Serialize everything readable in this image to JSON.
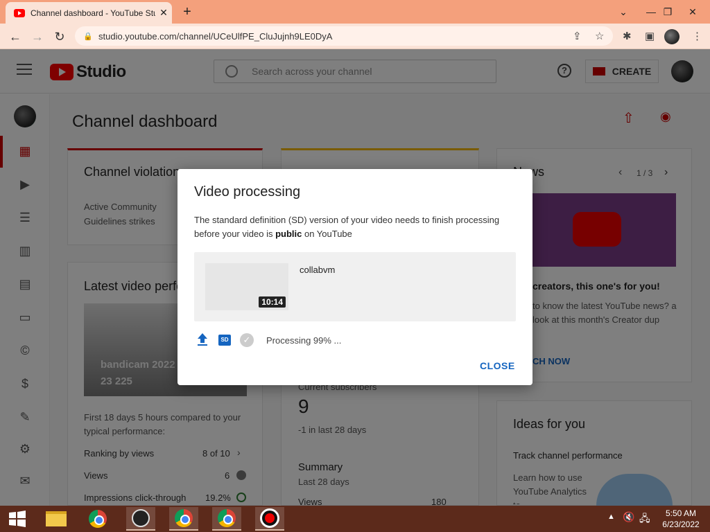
{
  "browser": {
    "tab_title": "Channel dashboard - YouTube Studio",
    "new_tab": "+",
    "tab_close": "✕",
    "url": "studio.youtube.com/channel/UCeUlfPE_CluJujnh9LE0DyA",
    "window_controls": [
      "⌄",
      "—",
      "❐",
      "✕"
    ]
  },
  "header": {
    "logo_text": "Studio",
    "search_placeholder": "Search across your channel",
    "help": "?",
    "create_label": "CREATE"
  },
  "page": {
    "title": "Channel dashboard"
  },
  "cards": {
    "violations": {
      "title": "Channel violations",
      "line1": "Active Community",
      "line2": "Guidelines strikes"
    },
    "latest": {
      "title": "Latest video performance",
      "thumb_title": "bandicam 2022",
      "thumb_views": "23 225",
      "compare": "First 18 days 5 hours compared to your typical performance:",
      "rows": [
        {
          "label": "Ranking by views",
          "value": "8 of 10"
        },
        {
          "label": "Views",
          "value": "6"
        },
        {
          "label": "Impressions click-through",
          "value": "19.2%"
        }
      ]
    },
    "analytics": {
      "subs_label": "Current subscribers",
      "subs_value": "9",
      "subs_change": "-1 in last 28 days",
      "summary": "Summary",
      "summary_sub": "Last 28 days",
      "views_label": "Views",
      "views_value": "180"
    },
    "news": {
      "title": "News",
      "pager": "1 / 3",
      "headline": "creators, this one's for you!",
      "body": "to know the latest YouTube news? a look at this month's Creator dup",
      "cta": "CH NOW"
    },
    "ideas": {
      "title": "Ideas for you",
      "sub": "Track channel performance",
      "body": "Learn how to use YouTube Analytics to"
    }
  },
  "dialog": {
    "title": "Video processing",
    "body_prefix": "The standard definition (SD) version of your video needs to finish processing before your video is ",
    "body_bold": "public",
    "body_suffix": " on YouTube",
    "video_name": "collabvm",
    "duration": "10:14",
    "sd_badge": "SD",
    "status": "Processing 99% ...",
    "close_label": "CLOSE"
  },
  "taskbar": {
    "time": "5:50 AM",
    "date": "6/23/2022"
  },
  "colors": {
    "accent_red": "#ff0000",
    "link_blue": "#1565c0",
    "tab_bar": "#f4a07c",
    "taskbar": "#5c2a1b"
  }
}
